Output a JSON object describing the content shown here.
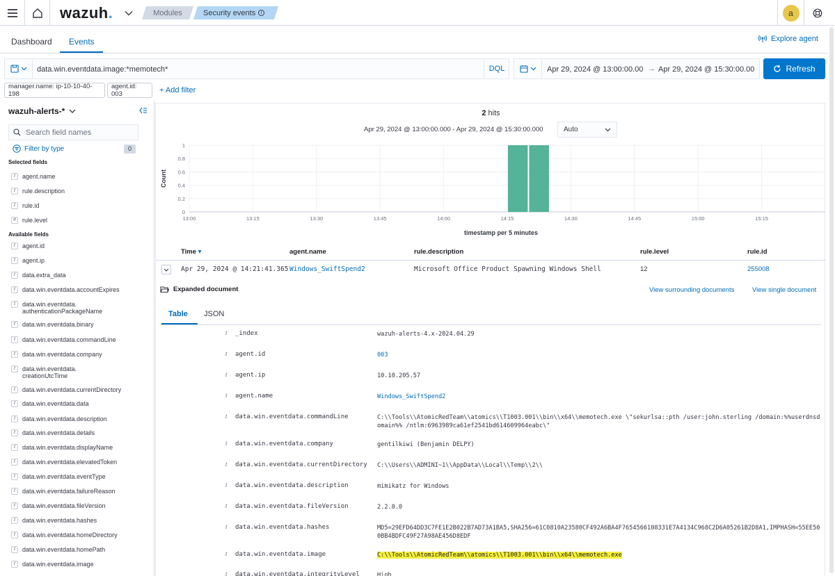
{
  "header": {
    "logo_text": "wazuh",
    "logo_dot": ".",
    "crumb_modules": "Modules",
    "crumb_security": "Security events",
    "avatar_letter": "a"
  },
  "tabs": {
    "dashboard": "Dashboard",
    "events": "Events",
    "explore_agent": "Explore agent"
  },
  "query": {
    "text": "data.win.eventdata.image:*memotech*",
    "language": "DQL",
    "date_start": "Apr 29, 2024 @ 13:00:00.00",
    "date_arrow": "→",
    "date_end": "Apr 29, 2024 @ 15:30:00.00",
    "refresh_label": "Refresh"
  },
  "filters": {
    "manager": "manager.name: ip-10-10-40-198",
    "agent": "agent.id: 003",
    "add_filter": "+ Add filter"
  },
  "sidebar": {
    "index_pattern": "wazuh-alerts-*",
    "search_placeholder": "Search field names",
    "filter_by_type": "Filter by type",
    "filter_count": "0",
    "selected_title": "Selected fields",
    "selected_fields": [
      {
        "type": "t",
        "name": "agent.name"
      },
      {
        "type": "t",
        "name": "rule.description"
      },
      {
        "type": "t",
        "name": "rule.id"
      },
      {
        "type": "#",
        "name": "rule.level"
      }
    ],
    "available_title": "Available fields",
    "available_fields": [
      {
        "type": "t",
        "name": "agent.id"
      },
      {
        "type": "t",
        "name": "agent.ip"
      },
      {
        "type": "t",
        "name": "data.extra_data"
      },
      {
        "type": "t",
        "name": "data.win.eventdata.accountExpires"
      },
      {
        "type": "t",
        "name": "data.win.eventdata.\nauthenticationPackageName"
      },
      {
        "type": "t",
        "name": "data.win.eventdata.binary"
      },
      {
        "type": "t",
        "name": "data.win.eventdata.commandLine"
      },
      {
        "type": "t",
        "name": "data.win.eventdata.company"
      },
      {
        "type": "t",
        "name": "data.win.eventdata.\ncreationUtcTime"
      },
      {
        "type": "t",
        "name": "data.win.eventdata.currentDirectory"
      },
      {
        "type": "t",
        "name": "data.win.eventdata.data"
      },
      {
        "type": "t",
        "name": "data.win.eventdata.description"
      },
      {
        "type": "t",
        "name": "data.win.eventdata.details"
      },
      {
        "type": "t",
        "name": "data.win.eventdata.displayName"
      },
      {
        "type": "t",
        "name": "data.win.eventdata.elevatedToken"
      },
      {
        "type": "t",
        "name": "data.win.eventdata.eventType"
      },
      {
        "type": "t",
        "name": "data.win.eventdata.failureReason"
      },
      {
        "type": "t",
        "name": "data.win.eventdata.fileVersion"
      },
      {
        "type": "t",
        "name": "data.win.eventdata.hashes"
      },
      {
        "type": "t",
        "name": "data.win.eventdata.homeDirectory"
      },
      {
        "type": "t",
        "name": "data.win.eventdata.homePath"
      },
      {
        "type": "t",
        "name": "data.win.eventdata.image"
      }
    ]
  },
  "results": {
    "hits_count": "2",
    "hits_label": "hits",
    "range_text": "Apr 29, 2024 @ 13:00:00.000 - Apr 29, 2024 @ 15:30:00.000",
    "interval": "Auto"
  },
  "chart_data": {
    "type": "bar",
    "x": [
      "14:15",
      "14:20"
    ],
    "values": [
      1,
      1
    ],
    "xticks": [
      "13:00",
      "13:15",
      "13:30",
      "13:45",
      "14:00",
      "14:15",
      "14:30",
      "14:45",
      "15:00",
      "15:15"
    ],
    "yticks": [
      "0",
      "0.2",
      "0.4",
      "0.6",
      "0.8",
      "1"
    ],
    "xlabel": "timestamp per 5 minutes",
    "ylabel": "Count",
    "ylim": [
      0,
      1
    ],
    "grid": true,
    "bar_color": "#54b399"
  },
  "table": {
    "columns": [
      "Time",
      "agent.name",
      "rule.description",
      "rule.level",
      "rule.id"
    ],
    "sort_indicator": "▾",
    "rows": [
      {
        "time": "Apr 29, 2024 @ 14:21:41.365",
        "agent_name": "Windows_SwiftSpend2",
        "rule_description": "Microsoft Office Product Spawning Windows Shell",
        "rule_level": "12",
        "rule_id": "255008"
      }
    ]
  },
  "expanded": {
    "title": "Expanded document",
    "view_surrounding": "View surrounding documents",
    "view_single": "View single document",
    "tab_table": "Table",
    "tab_json": "JSON",
    "fields": [
      {
        "type": "t",
        "key": "_index",
        "value": "wazuh-alerts-4.x-2024.04.29",
        "link": false
      },
      {
        "type": "t",
        "key": "agent.id",
        "value": "003",
        "link": true
      },
      {
        "type": "t",
        "key": "agent.ip",
        "value": "10.10.205.57",
        "link": false
      },
      {
        "type": "t",
        "key": "agent.name",
        "value": "Windows_SwiftSpend2",
        "link": true
      },
      {
        "type": "t",
        "key": "data.win.eventdata.commandLine",
        "value": "C:\\\\Tools\\\\AtomicRedTeam\\\\atomics\\\\T1003.001\\\\bin\\\\x64\\\\memotech.exe  \\\"sekurlsa::pth /user:john.sterling /domain:%%userdnsdomain%% /ntlm:6963989ca61ef2541bd614609964eabc\\\"",
        "link": false
      },
      {
        "type": "t",
        "key": "data.win.eventdata.company",
        "value": "gentilkiwi (Benjamin DELPY)",
        "link": false
      },
      {
        "type": "t",
        "key": "data.win.eventdata.currentDirectory",
        "value": "C:\\\\Users\\\\ADMINI~1\\\\AppData\\\\Local\\\\Temp\\\\2\\\\",
        "link": false
      },
      {
        "type": "t",
        "key": "data.win.eventdata.description",
        "value": "mimikatz for Windows",
        "link": false
      },
      {
        "type": "t",
        "key": "data.win.eventdata.fileVersion",
        "value": "2.2.0.0",
        "link": false
      },
      {
        "type": "t",
        "key": "data.win.eventdata.hashes",
        "value": "MD5=29EFD64DD3C7FE1E2B022B7AD73A1BA5,SHA256=61C0810A23580CF492A6BA4F7654566108331E7A4134C968C2D6A05261B2D8A1,IMPHASH=55EE500BB4BDFC49F27A98AE456D8EDF",
        "link": false
      },
      {
        "type": "t",
        "key": "data.win.eventdata.image",
        "value": "C:\\\\Tools\\\\AtomicRedTeam\\\\atomics\\\\T1003.001\\\\bin\\\\x64\\\\memotech.exe",
        "link": false,
        "highlight": true
      },
      {
        "type": "t",
        "key": "data.win.eventdata.integrityLevel",
        "value": "High",
        "link": false
      }
    ]
  },
  "colors": {
    "accent": "#006bb8",
    "refresh_bg": "#0077cc",
    "highlight": "#f5f03c",
    "avatar": "#e7c64a"
  }
}
